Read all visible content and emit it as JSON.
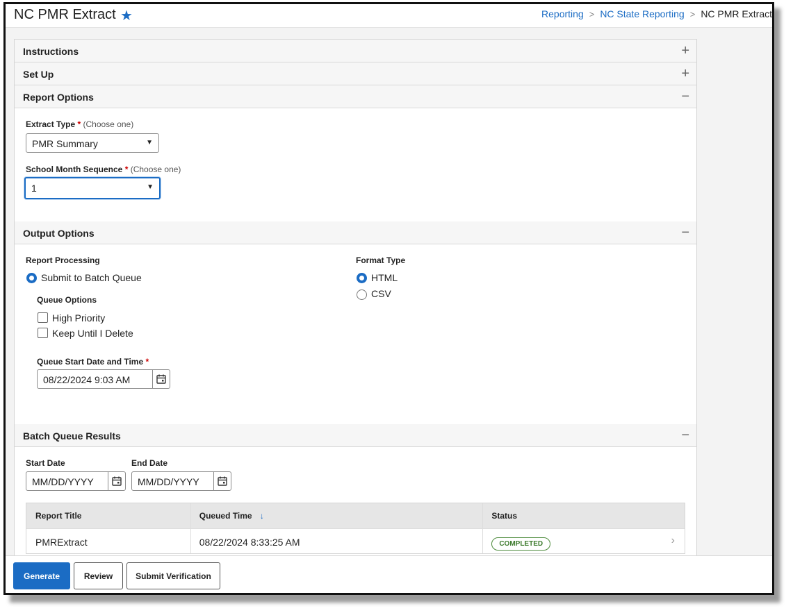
{
  "header": {
    "title": "NC PMR Extract",
    "breadcrumb": [
      "Reporting",
      "NC State Reporting",
      "NC PMR Extract"
    ],
    "breadcrumb_sep": ">"
  },
  "sections": {
    "instructions": {
      "title": "Instructions",
      "toggle": "+"
    },
    "setup": {
      "title": "Set Up",
      "toggle": "+"
    },
    "report_options": {
      "title": "Report Options",
      "toggle": "−"
    },
    "output_options": {
      "title": "Output Options",
      "toggle": "−"
    },
    "batch_results": {
      "title": "Batch Queue Results",
      "toggle": "−"
    }
  },
  "report_options": {
    "extract_type_label": "Extract Type",
    "extract_type_req": "*",
    "extract_type_hint": "(Choose one)",
    "extract_type_value": "PMR Summary",
    "month_seq_label": "School Month Sequence",
    "month_seq_req": "*",
    "month_seq_hint": "(Choose one)",
    "month_seq_value": "1"
  },
  "output_options": {
    "processing_label": "Report Processing",
    "batch_queue_label": "Submit to Batch Queue",
    "queue_options_label": "Queue Options",
    "high_priority_label": "High Priority",
    "keep_label": "Keep Until I Delete",
    "start_label": "Queue Start Date and Time",
    "start_req": "*",
    "start_value": "08/22/2024 9:03 AM",
    "format_label": "Format Type",
    "format_html": "HTML",
    "format_csv": "CSV"
  },
  "batch": {
    "start_date_label": "Start Date",
    "start_date_placeholder": "MM/DD/YYYY",
    "end_date_label": "End Date",
    "end_date_placeholder": "MM/DD/YYYY",
    "columns": [
      "Report Title",
      "Queued Time",
      "Status"
    ],
    "sort_icon": "↓",
    "rows": [
      {
        "title": "PMRExtract",
        "queued": "08/22/2024 8:33:25 AM",
        "status": "COMPLETED"
      }
    ]
  },
  "footer": {
    "generate": "Generate",
    "review": "Review",
    "submit_verification": "Submit Verification"
  },
  "colors": {
    "accent": "#1b6cc4",
    "required": "#cc0000",
    "status_ok": "#3c7a2c"
  }
}
